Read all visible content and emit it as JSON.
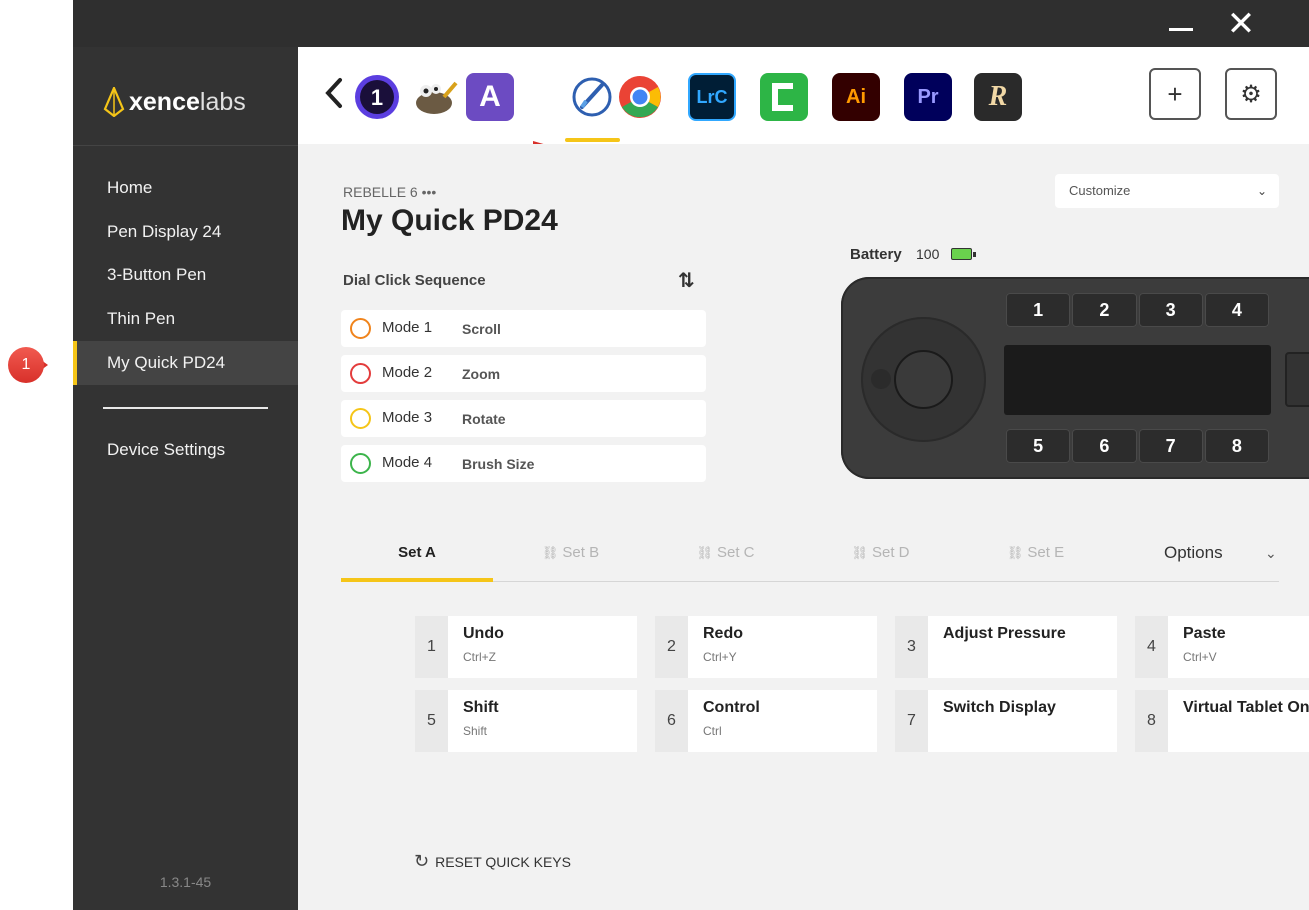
{
  "window": {
    "minimize_glyph": "—",
    "close_glyph": "✕"
  },
  "sidebar": {
    "brand_bold": "xence",
    "brand_light": "labs",
    "items": [
      {
        "label": "Home"
      },
      {
        "label": "Pen Display 24"
      },
      {
        "label": "3-Button Pen"
      },
      {
        "label": "Thin Pen"
      },
      {
        "label": "My Quick PD24",
        "active": true
      },
      {
        "label": "Device Settings"
      }
    ],
    "version": "1.3.1-45"
  },
  "appbar": {
    "back_glyph": "‹",
    "apps": [
      {
        "icon": "affinity-photo-icon",
        "text": "1",
        "color": "#2a1f6e"
      },
      {
        "icon": "gimp-icon",
        "text": "",
        "color": "#8c7a5c"
      },
      {
        "icon": "affinity-publisher-icon",
        "text": "A",
        "color": "#6c4bc2"
      },
      {
        "icon": "rebelle-icon",
        "text": "",
        "color": "#ffffff",
        "selected": true
      },
      {
        "icon": "chrome-icon",
        "text": "",
        "color": "#ea4335"
      },
      {
        "icon": "lightroom-classic-icon",
        "text": "LrC",
        "color": "#001e36"
      },
      {
        "icon": "camtasia-icon",
        "text": "",
        "color": "#2db546"
      },
      {
        "icon": "illustrator-icon",
        "text": "Ai",
        "color": "#330000"
      },
      {
        "icon": "premiere-icon",
        "text": "Pr",
        "color": "#00005b"
      },
      {
        "icon": "rebelle-r-icon",
        "text": "R",
        "color": "#2a2a2a"
      }
    ],
    "add_glyph": "+",
    "settings_glyph": "⚙"
  },
  "content": {
    "app_caption": "REBELLE 6 •••",
    "title": "My Quick PD24",
    "customize": "Customize",
    "dial_heading": "Dial Click Sequence",
    "sort_glyph": "⇅",
    "modes": [
      {
        "name": "Mode 1",
        "action": "Scroll",
        "color": "#f0841c"
      },
      {
        "name": "Mode 2",
        "action": "Zoom",
        "color": "#e33c3c"
      },
      {
        "name": "Mode 3",
        "action": "Rotate",
        "color": "#f5c518"
      },
      {
        "name": "Mode 4",
        "action": "Brush Size",
        "color": "#3cb44b"
      }
    ],
    "battery_label": "Battery",
    "battery_value": "100",
    "device_keys_top": [
      "1",
      "2",
      "3",
      "4"
    ],
    "device_keys_bottom": [
      "5",
      "6",
      "7",
      "8"
    ],
    "device_brand": "xencelabs",
    "tabs": [
      {
        "label": "Set A",
        "active": true,
        "link_glyph": ""
      },
      {
        "label": "Set B",
        "active": false,
        "link_glyph": "⛓"
      },
      {
        "label": "Set C",
        "active": false,
        "link_glyph": "⛓"
      },
      {
        "label": "Set D",
        "active": false,
        "link_glyph": "⛓"
      },
      {
        "label": "Set E",
        "active": false,
        "link_glyph": "⛓"
      }
    ],
    "options": "Options",
    "options_chev": "⌄",
    "quick_keys": [
      {
        "num": "1",
        "title": "Undo",
        "sub": "Ctrl+Z"
      },
      {
        "num": "2",
        "title": "Redo",
        "sub": "Ctrl+Y"
      },
      {
        "num": "3",
        "title": "Adjust Pressure",
        "sub": ""
      },
      {
        "num": "4",
        "title": "Paste",
        "sub": "Ctrl+V"
      },
      {
        "num": "5",
        "title": "Shift",
        "sub": "Shift"
      },
      {
        "num": "6",
        "title": "Control",
        "sub": "Ctrl"
      },
      {
        "num": "7",
        "title": "Switch Display",
        "sub": ""
      },
      {
        "num": "8",
        "title": "Virtual Tablet On/...",
        "sub": ""
      }
    ],
    "reset": "RESET QUICK KEYS",
    "reset_glyph": "↻"
  },
  "callouts": [
    {
      "label": "1"
    },
    {
      "label": "2"
    }
  ],
  "colors": {
    "accent": "#f5c518",
    "sidebar_bg": "#333333",
    "content_bg": "#f2f2f2"
  }
}
